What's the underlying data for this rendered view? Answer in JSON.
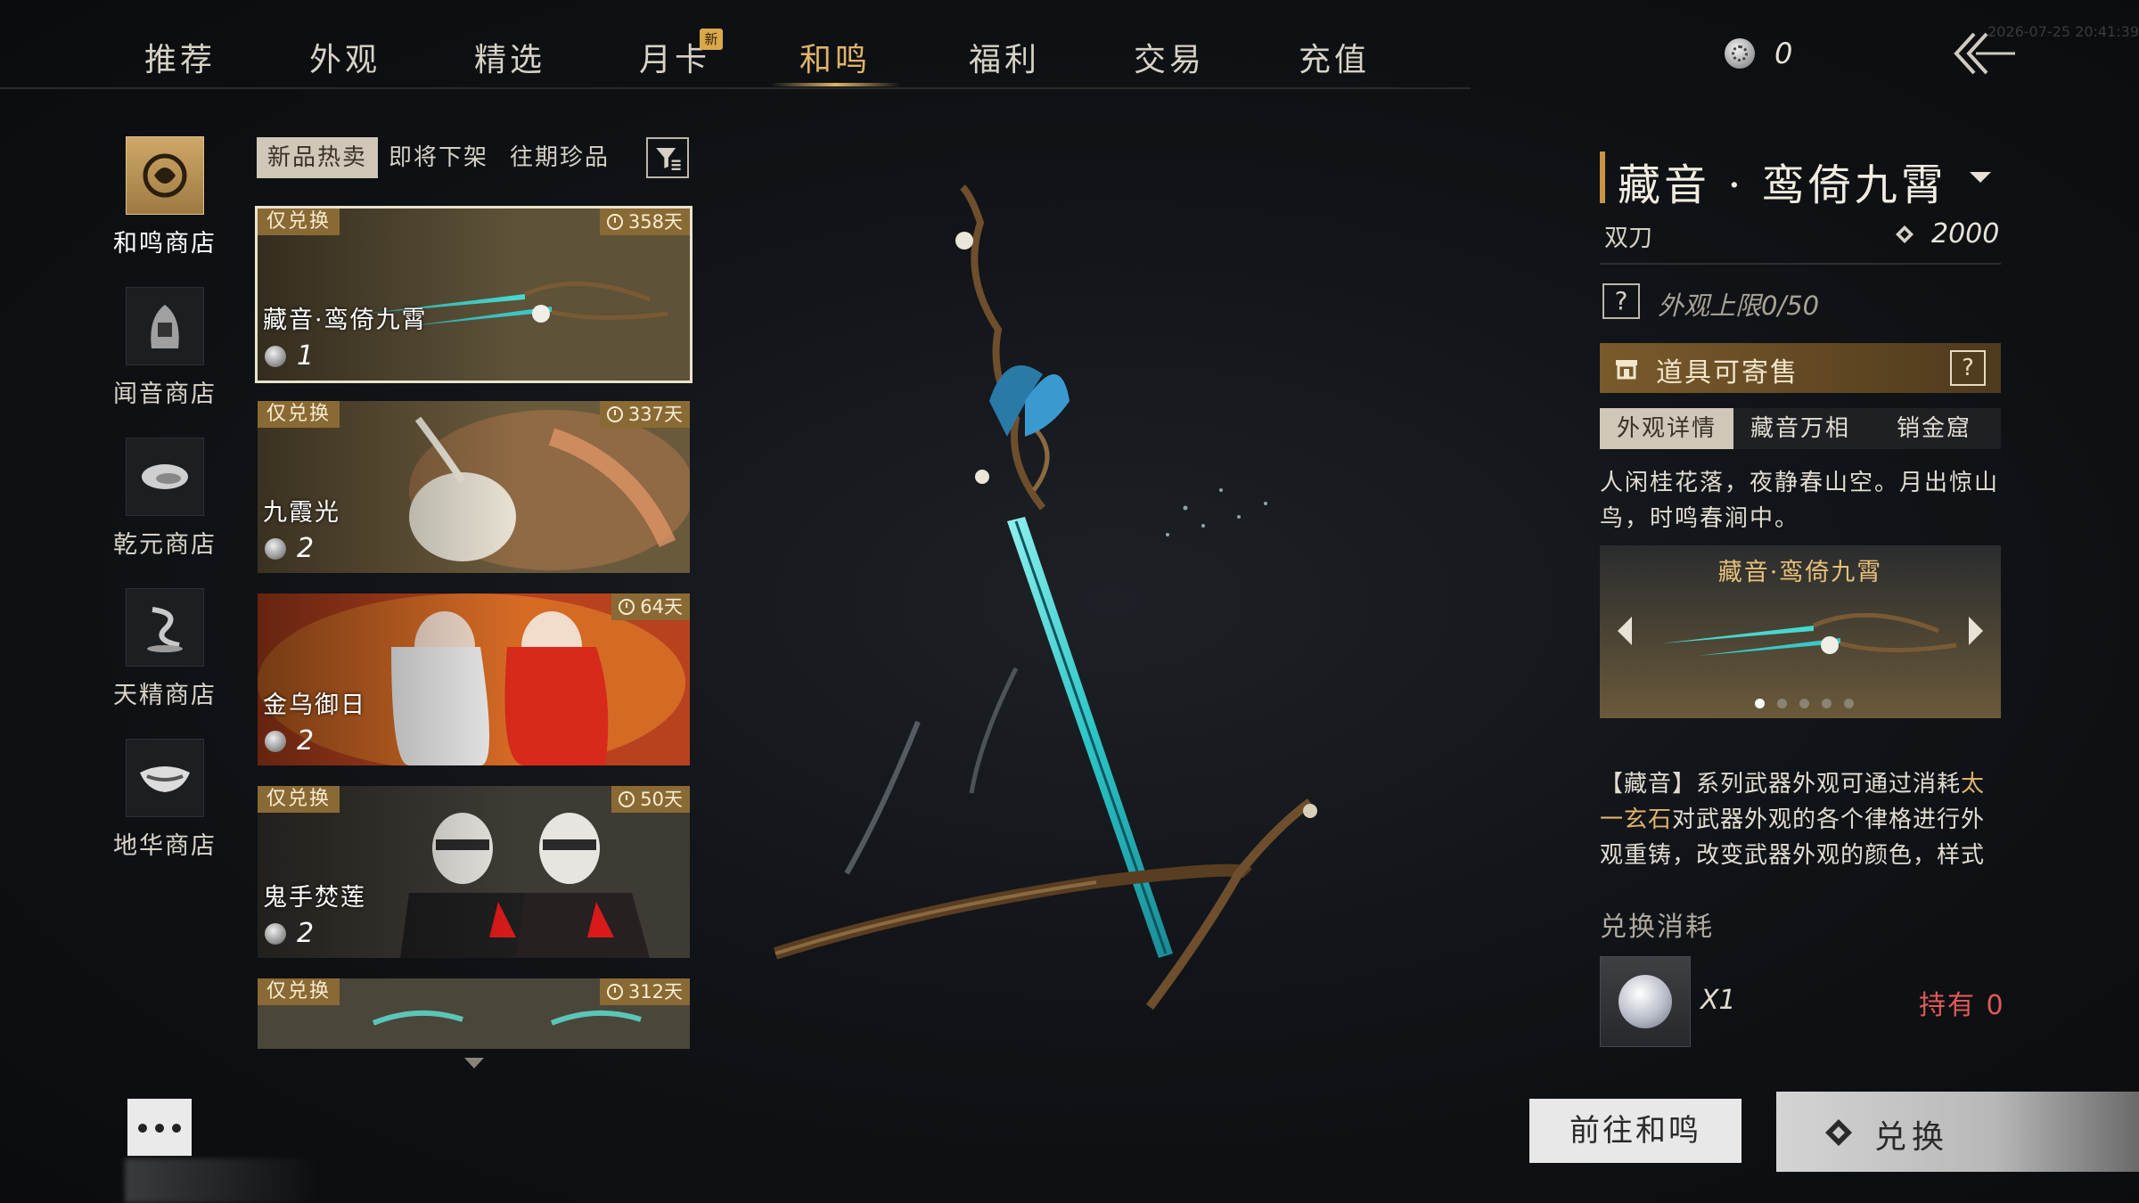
{
  "nav": {
    "tabs": [
      {
        "label": "推荐"
      },
      {
        "label": "外观"
      },
      {
        "label": "精选"
      },
      {
        "label": "月卡",
        "badge": "新"
      },
      {
        "label": "和鸣",
        "active": true
      },
      {
        "label": "福利"
      },
      {
        "label": "交易"
      },
      {
        "label": "充值"
      }
    ],
    "currency_value": "0",
    "timestamp": "2026-07-25 20:41:39"
  },
  "shops": [
    {
      "label": "和鸣商店",
      "active": true
    },
    {
      "label": "闻音商店"
    },
    {
      "label": "乾元商店"
    },
    {
      "label": "天精商店"
    },
    {
      "label": "地华商店"
    }
  ],
  "list": {
    "subtabs": [
      "新品热卖",
      "即将下架",
      "往期珍品"
    ],
    "items": [
      {
        "badge": "仅兑换",
        "days": "358天",
        "name": "藏音·鸾倚九霄",
        "cost": "1",
        "selected": true
      },
      {
        "badge": "仅兑换",
        "days": "337天",
        "name": "九霞光",
        "cost": "2"
      },
      {
        "badge": "",
        "days": "64天",
        "name": "金乌御日",
        "cost": "2"
      },
      {
        "badge": "仅兑换",
        "days": "50天",
        "name": "鬼手焚莲",
        "cost": "2"
      },
      {
        "badge": "仅兑换",
        "days": "312天",
        "name": "",
        "cost": ""
      }
    ]
  },
  "detail": {
    "title": "藏音 · 鸾倚九霄",
    "type": "双刀",
    "score": "2000",
    "limit_text": "外观上限0/50",
    "question_mark": "?",
    "consign_text": "道具可寄售",
    "tabs": [
      "外观详情",
      "藏音万相",
      "销金窟"
    ],
    "poem": "人闲桂花落，夜静春山空。月出惊山鸟，时鸣春涧中。",
    "preview_title": "藏音·鸾倚九霄",
    "preview_dots": 5,
    "desc_before": "【藏音】系列武器外观可通过消耗",
    "desc_highlight": "太一玄石",
    "desc_after": "对武器外观的各个律格进行外观重铸，改变武器外观的颜色，样式",
    "cost_label": "兑换消耗",
    "cost_qty": "X1",
    "owned": "持有 0"
  },
  "buttons": {
    "goto": "前往和鸣",
    "exchange": "兑换"
  },
  "colors": {
    "accent_gold": "#e0b36a",
    "badge_brown": "#8a6a34",
    "owned_red": "#e05a5a",
    "blade_cyan": "#3ad6d6"
  }
}
